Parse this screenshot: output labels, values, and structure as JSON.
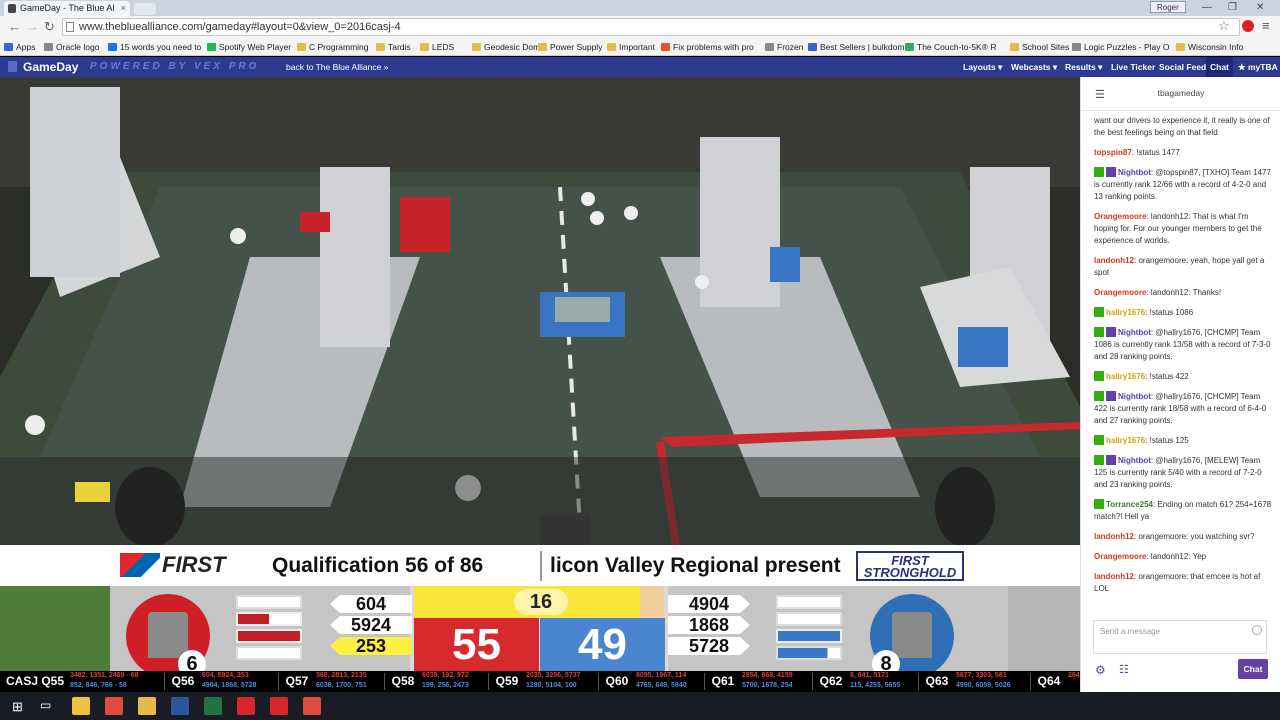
{
  "browser": {
    "tab_title": "GameDay - The Blue Al",
    "tab_close": "×",
    "profile_name": "Roger",
    "url": "www.thebluealliance.com/gameday#layout=0&view_0=2016casj-4",
    "window_controls": [
      "—",
      "❐",
      "✕"
    ]
  },
  "bookmarks": [
    {
      "label": "Apps",
      "color": "#3367d6"
    },
    {
      "label": "Oracle logo",
      "color": "#888"
    },
    {
      "label": "15 words you need to",
      "color": "#1a73e8"
    },
    {
      "label": "Spotify Web Player",
      "color": "#1db954"
    },
    {
      "label": "C Programming",
      "color": "#e8b84a"
    },
    {
      "label": "Tardis",
      "color": "#e8b84a"
    },
    {
      "label": "LEDS",
      "color": "#e8b84a"
    },
    {
      "label": "Geodesic Dome",
      "color": "#e8b84a"
    },
    {
      "label": "Power Supply",
      "color": "#e8b84a"
    },
    {
      "label": "Important",
      "color": "#e8b84a"
    },
    {
      "label": "Fix problems with pro",
      "color": "#f25022"
    },
    {
      "label": "Frozen",
      "color": "#888"
    },
    {
      "label": "Best Sellers | bulkdom",
      "color": "#3366cc"
    },
    {
      "label": "The Couch-to-5K® R",
      "color": "#3a6"
    },
    {
      "label": "School Sites",
      "color": "#e8b84a"
    },
    {
      "label": "Logic Puzzles - Play O",
      "color": "#888"
    },
    {
      "label": "Wisconsin Info",
      "color": "#e8b84a"
    }
  ],
  "gameday_nav": {
    "brand": "GameDay",
    "powered": "POWERED BY VEX PRO",
    "back_link": "back to The Blue Alliance »",
    "items": [
      "Layouts ▾",
      "Webcasts ▾",
      "Results ▾",
      "Live Ticker",
      "Social Feed",
      "Chat",
      "★ myTBA"
    ],
    "selected": "Chat"
  },
  "scoreboard": {
    "match_title": "Qualification 56 of 86",
    "event_title": "licon Valley Regional present",
    "first_logo": "FIRST",
    "game_logo": [
      "FIRST",
      "STRONGHOLD"
    ],
    "timer": "16",
    "red": {
      "score": "55",
      "teams": [
        "604",
        "5924",
        "253"
      ],
      "highlighted_team": "253",
      "tower_strength": "6",
      "color": "#d82a2e"
    },
    "blue": {
      "score": "49",
      "teams": [
        "4904",
        "1868",
        "5728"
      ],
      "tower_strength": "8",
      "color": "#4a86d0"
    }
  },
  "ticker": {
    "current": "CASJ Q55",
    "current_red": "3482, 1351, 2489 - 68",
    "current_blue": "852, 846, 766 - 58",
    "matches": [
      {
        "label": "Q56",
        "red": "604, 5924, 253",
        "blue": "4904, 1868, 5728"
      },
      {
        "label": "Q57",
        "red": "368, 2813, 2135",
        "blue": "6036, 1700, 751"
      },
      {
        "label": "Q58",
        "red": "6039, 192, 972",
        "blue": "199, 256, 2473"
      },
      {
        "label": "Q59",
        "red": "2035, 3256, 5737",
        "blue": "1280, 5104, 100"
      },
      {
        "label": "Q60",
        "red": "8095, 1967, 114",
        "blue": "4765, 649, 5940"
      },
      {
        "label": "Q61",
        "red": "2854, 668, 4159",
        "blue": "5700, 1678, 254"
      },
      {
        "label": "Q62",
        "red": "8, 841, 5171",
        "blue": "115, 4255, 5655"
      },
      {
        "label": "Q63",
        "red": "5677, 3303, 581",
        "blue": "4990, 6059, 5026"
      },
      {
        "label": "Q64",
        "red": "264",
        "blue": ""
      }
    ]
  },
  "chat": {
    "channel": "tbagameday",
    "messages": [
      {
        "user": "",
        "user_color": "#333",
        "badges": false,
        "text": "want our drivers to experience it, it really is one of the best feelings being on that field"
      },
      {
        "user": "topspin87",
        "user_color": "#d2381e",
        "badges": false,
        "text": "!status 1477"
      },
      {
        "user": "Nightbot",
        "user_color": "#5a3fb0",
        "badges": true,
        "text": "@topspin87, [TXHO] Team 1477 is currently rank 12/66 with a record of 4-2-0 and 13 ranking points."
      },
      {
        "user": "Orangemoore",
        "user_color": "#d2381e",
        "badges": false,
        "text": "landonh12: That is what I'm hoping for. For our younger members to get the experience of worlds."
      },
      {
        "user": "landonh12",
        "user_color": "#d2381e",
        "badges": false,
        "text": "orangemoore: yeah, hope yall get a spot"
      },
      {
        "user": "Orangemoore",
        "user_color": "#d2381e",
        "badges": false,
        "text": "landonh12: Thanks!"
      },
      {
        "user": "hallry1676",
        "user_color": "#d9a400",
        "badges": true,
        "text": "!status 1086"
      },
      {
        "user": "Nightbot",
        "user_color": "#5a3fb0",
        "badges": true,
        "text": "@hallry1676, [CHCMP] Team 1086 is currently rank 13/58 with a record of 7-3-0 and 28 ranking points."
      },
      {
        "user": "hallry1676",
        "user_color": "#d9a400",
        "badges": true,
        "text": "!status 422"
      },
      {
        "user": "Nightbot",
        "user_color": "#5a3fb0",
        "badges": true,
        "text": "@hallry1676, [CHCMP] Team 422 is currently rank 18/58 with a record of 6-4-0 and 27 ranking points."
      },
      {
        "user": "hallry1676",
        "user_color": "#d9a400",
        "badges": true,
        "text": "!status 125"
      },
      {
        "user": "Nightbot",
        "user_color": "#5a3fb0",
        "badges": true,
        "text": "@hallry1676, [MELEW] Team 125 is currently rank 5/40 with a record of 7-2-0 and 23 ranking points."
      },
      {
        "user": "Torrance254",
        "user_color": "#2a8a2a",
        "badges": true,
        "text": "Ending on match 61? 254+1678 match?! Hell ya"
      },
      {
        "user": "landonh12",
        "user_color": "#d2381e",
        "badges": false,
        "text": "orangemoore: you watching svr?"
      },
      {
        "user": "Orangemoore",
        "user_color": "#d2381e",
        "badges": false,
        "text": "landonh12: Yep"
      },
      {
        "user": "landonh12",
        "user_color": "#d2381e",
        "badges": false,
        "text": "orangemoore: that emcee is hot af LOL"
      }
    ],
    "input_placeholder": "Send a message",
    "send_label": "Chat"
  },
  "taskbar_apps": [
    {
      "name": "file-explorer-icon",
      "color": "#f0c040"
    },
    {
      "name": "chrome-icon",
      "color": "#e04b3c"
    },
    {
      "name": "folder-icon",
      "color": "#e8b84a"
    },
    {
      "name": "word-icon",
      "color": "#2b579a"
    },
    {
      "name": "excel-icon",
      "color": "#217346"
    },
    {
      "name": "solidworks-icon",
      "color": "#d7282f"
    },
    {
      "name": "solidworks-icon-2",
      "color": "#d7282f"
    },
    {
      "name": "chrome-icon-2",
      "color": "#e04b3c"
    }
  ]
}
